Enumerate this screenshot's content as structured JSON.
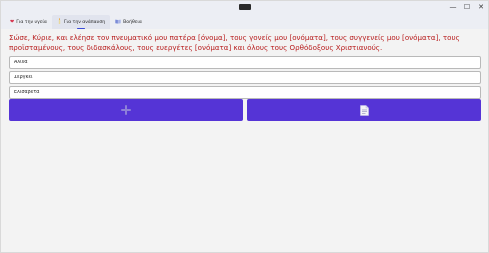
{
  "window": {
    "controls": {
      "minimize": "—",
      "maximize": "☐",
      "close": "✕"
    }
  },
  "tabs": [
    {
      "icon": "heart-icon",
      "label": "Για την υγεία",
      "active": false
    },
    {
      "icon": "candle-icon",
      "label": "Για την ανάπαυση",
      "active": true
    },
    {
      "icon": "book-icon",
      "label": "Βοήθεια",
      "active": false
    }
  ],
  "prayer": {
    "text": "Σώσε, Κύριε, και ελέησε τον πνευματικό μου πατέρα [όνομα], τους γονείς μου [ονόματα], τους συγγενείς μου [ονόματα], τους προϊσταμένους, τους διδασκάλους, τους ευεργέτες [ονόματα] και όλους τους Ορθόδοξους Χριστιανούς.",
    "color": "#b71c1c"
  },
  "names": [
    {
      "value": "Αλίνα"
    },
    {
      "value": "Σεργκέι"
    },
    {
      "value": "Ελισαβέτα"
    }
  ],
  "buttons": {
    "add": {
      "icon": "plus-icon",
      "color": "#5534d6"
    },
    "document": {
      "icon": "document-icon",
      "color": "#5534d6"
    }
  }
}
